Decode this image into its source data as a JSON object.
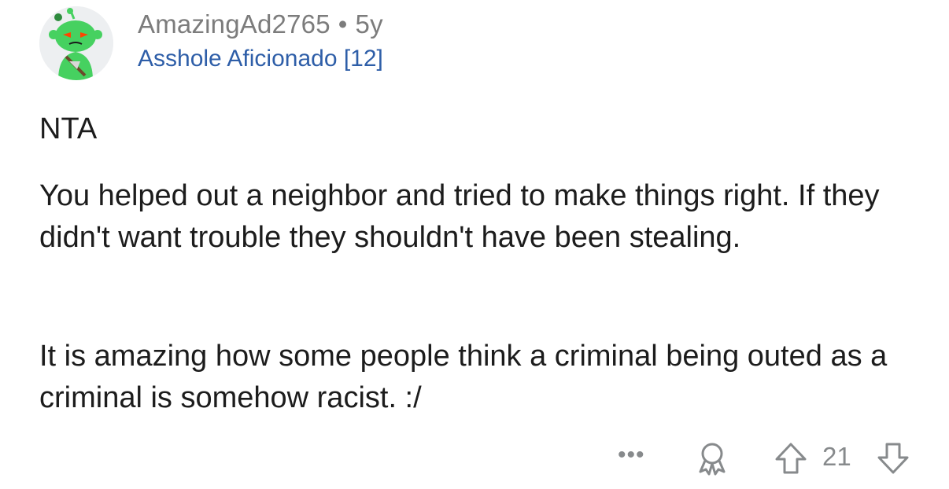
{
  "comment": {
    "author": "AmazingAd2765",
    "separator": "•",
    "age": "5y",
    "flair": "Asshole Aficionado [12]",
    "paragraphs": [
      "NTA",
      "You helped out a neighbor and tried to make things right. If they didn't want trouble they shouldn't have been stealing.",
      "It is amazing how some people think a criminal being outed as a criminal is somehow racist. :/"
    ],
    "avatar_icon": "snoo-avatar-icon"
  },
  "actions": {
    "more_label": "•••",
    "award_icon": "award-icon",
    "upvote_icon": "upvote-arrow-icon",
    "score": "21",
    "downvote_icon": "downvote-arrow-icon"
  },
  "colors": {
    "username": "#7c7c7c",
    "flair": "#2e5ea8",
    "text": "#1c1c1c",
    "icon_gray": "#878a8c",
    "avatar_green": "#46d160"
  }
}
